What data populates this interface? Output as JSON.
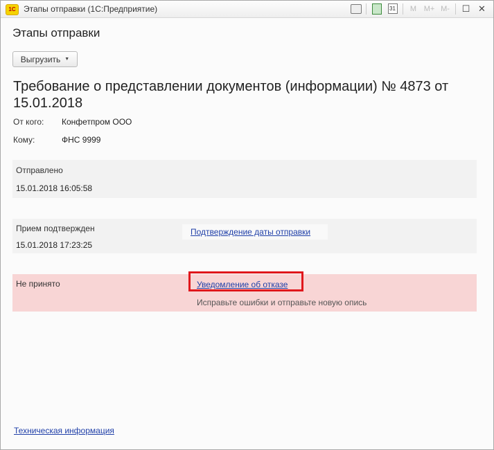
{
  "window": {
    "title": "Этапы отправки  (1С:Предприятие)",
    "logo_text": "1С",
    "toolbar": [
      "print-icon",
      "calculator-icon",
      "calendar-icon",
      "M",
      "M+",
      "M-",
      "restore-window-icon",
      "close-icon"
    ],
    "calendar_day": "31",
    "m_labels": [
      "M",
      "M+",
      "M-"
    ],
    "restore_glyph": "☐",
    "close_glyph": "✕"
  },
  "form": {
    "heading": "Этапы отправки",
    "export_button": "Выгрузить",
    "doc_title": "Требование о представлении документов (информации) № 4873 от 15.01.2018",
    "from_label": "От кого:",
    "from_value": "Конфетпром ООО",
    "to_label": "Кому:",
    "to_value": "ФНС 9999"
  },
  "stages": [
    {
      "status": "Отправлено",
      "date": "15.01.2018 16:05:58",
      "link": "",
      "note": ""
    },
    {
      "status": "Прием подтвержден",
      "date": "15.01.2018 17:23:25",
      "link": "Подтверждение даты отправки",
      "note": ""
    },
    {
      "status": "Не принято",
      "date": "",
      "link": "Уведомление об отказе",
      "note": "Исправьте ошибки и отправьте новую опись"
    }
  ],
  "footer": {
    "tech_info_link": "Техническая информация"
  },
  "colors": {
    "accent_link": "#1f3fa8",
    "error_panel": "#f8d5d5",
    "highlight_border": "#e0171c",
    "panel_gray": "#f2f2f2"
  }
}
